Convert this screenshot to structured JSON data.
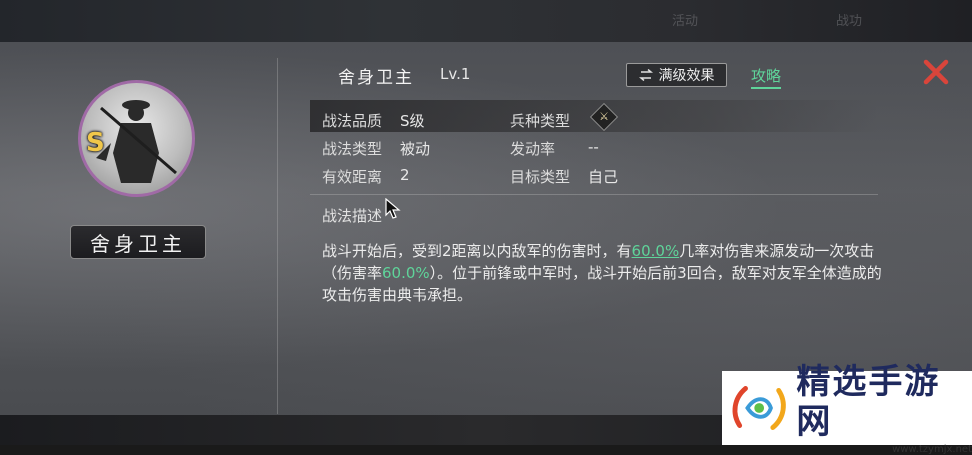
{
  "top_bar": {
    "faded_texts": [
      "活动",
      "战功"
    ]
  },
  "portrait": {
    "grade": "S",
    "plate_label": "舍身卫主",
    "ring_color": "#a06aa6",
    "grade_color": "#f0c74a"
  },
  "header": {
    "skill_name": "舍身卫主",
    "level": "Lv.1",
    "max_effect_icon": "swap-arrows-icon",
    "max_effect_label": "满级效果",
    "guide_label": "攻略",
    "accent_color": "#5fd49a",
    "close_icon": "close-x-icon",
    "close_color": "#d9453b"
  },
  "attributes": {
    "quality_label": "战法品质",
    "quality_value": "S级",
    "type_label": "战法类型",
    "type_value": "被动",
    "range_label": "有效距离",
    "range_value": "2",
    "troop_label": "兵种类型",
    "troop_icon": "crossed-weapons-icon",
    "trigger_label": "发动率",
    "trigger_value": "--",
    "target_label": "目标类型",
    "target_value": "自己"
  },
  "description": {
    "title": "战法描述",
    "part1": "战斗开始后，受到2距离以内敌军的伤害时，有",
    "rate1": "60.0%",
    "part2": "几率对伤害来源发动一次攻击（伤害率",
    "rate2": "60.0%",
    "part3": "）。位于前锋或中军时，战斗开始后前3回合，敌军对友军全体造成的攻击伤害由典韦承担。"
  },
  "watermark": {
    "title": "精选手游网",
    "url": "www.tzymjx.net"
  }
}
